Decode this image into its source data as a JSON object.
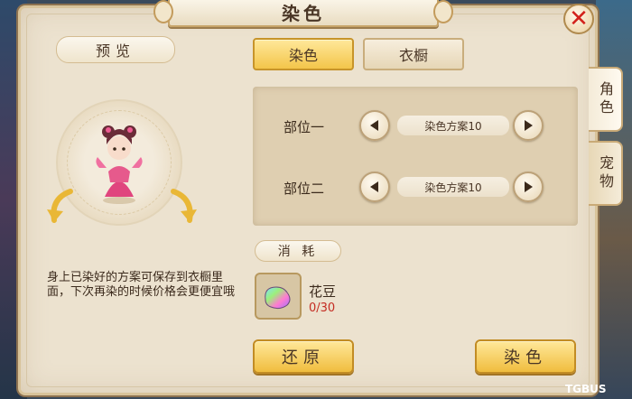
{
  "title": "染色",
  "close_icon": "close-x-icon",
  "side_tabs": [
    "角色",
    "宠物"
  ],
  "preview": {
    "label": "预览",
    "hint": "身上已染好的方案可保存到衣橱里面，下次再染的时候价格会更便宜哦"
  },
  "tabs": {
    "dye": "染色",
    "wardrobe": "衣橱"
  },
  "parts": [
    {
      "label": "部位一",
      "scheme": "染色方案10"
    },
    {
      "label": "部位二",
      "scheme": "染色方案10"
    }
  ],
  "cost": {
    "label": "消 耗",
    "item_name": "花豆",
    "item_count": "0/30"
  },
  "buttons": {
    "restore": "还原",
    "dye": "染色"
  },
  "watermark": "TGBUS",
  "colors": {
    "accent": "#f3c54a",
    "count_red": "#c42c22",
    "close_red": "#d2211a"
  }
}
